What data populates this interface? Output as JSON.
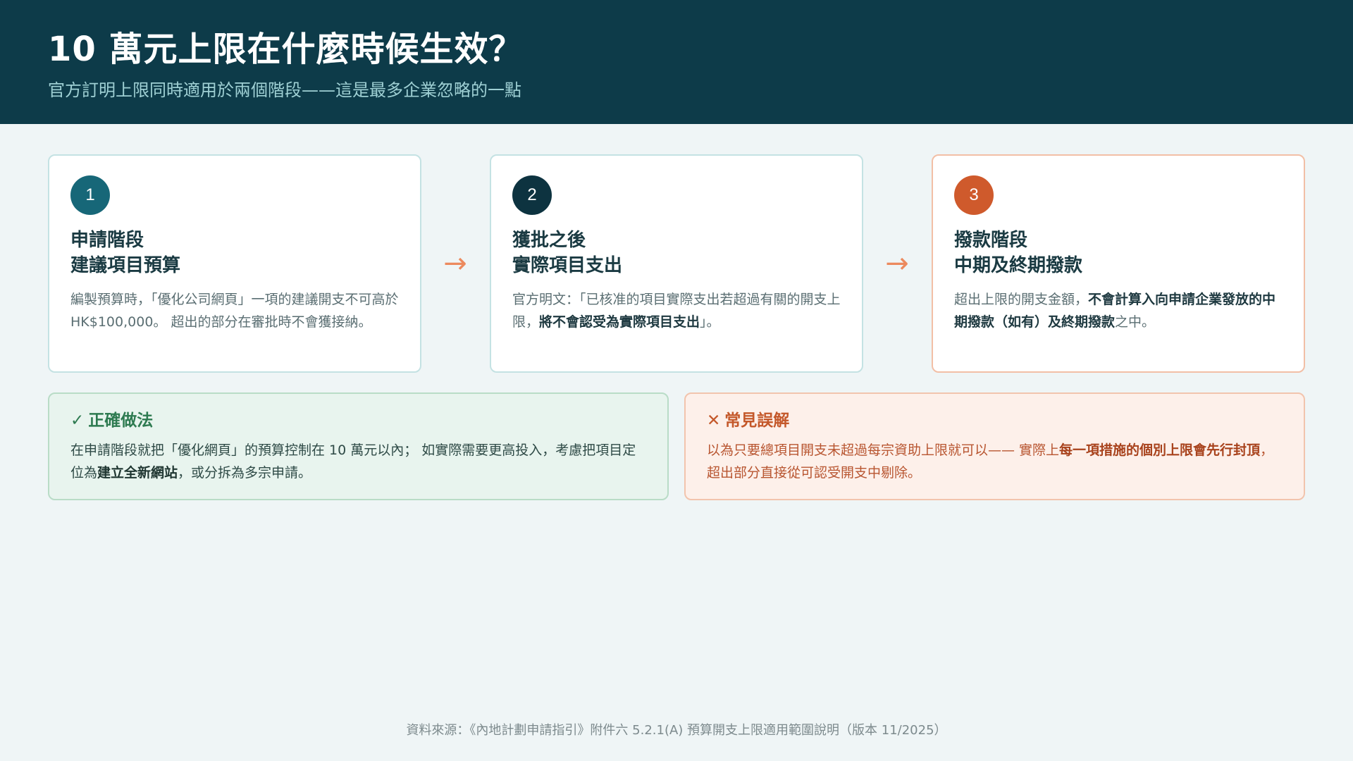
{
  "header": {
    "title": "10 萬元上限在什麼時候生效？",
    "subtitle": "官方訂明上限同時適用於兩個階段——這是最多企業忽略的一點"
  },
  "steps": [
    {
      "number": "1",
      "heading_line1": "申請階段",
      "heading_line2": "建議項目預算",
      "body": "編製預算時，「優化公司網頁」一項的建議開支不可高於 HK$100,000。 超出的部分在審批時不會獲接納。"
    },
    {
      "number": "2",
      "heading_line1": "獲批之後",
      "heading_line2": "實際項目支出",
      "body_prefix": "官方明文：「已核准的項目實際支出若超過有關的開支上限，",
      "body_bold": "將不會認受為實際項目支出",
      "body_suffix": "」。"
    },
    {
      "number": "3",
      "heading_line1": "撥款階段",
      "heading_line2": "中期及終期撥款",
      "body_prefix": "超出上限的開支金額，",
      "body_bold": "不會計算入向申請企業發放的中期撥款（如有）及終期撥款",
      "body_suffix": "之中。"
    }
  ],
  "arrows": [
    "→",
    "→"
  ],
  "correct": {
    "mark": "✓",
    "title": "正確做法",
    "body_prefix": "在申請階段就把「優化網頁」的預算控制在 10 萬元以內； 如實際需要更高投入，考慮把項目定位為",
    "body_bold": "建立全新網站",
    "body_suffix": "，或分拆為多宗申請。"
  },
  "misconception": {
    "mark": "✕",
    "title": "常見誤解",
    "body_prefix": "以為只要總項目開支未超過每宗資助上限就可以—— 實際上",
    "body_bold": "每一項措施的個別上限會先行封頂",
    "body_suffix": "，超出部分直接從可認受開支中剔除。"
  },
  "footer": "資料來源：《內地計劃申請指引》附件六 5.2.1(A) 預算開支上限適用範圍說明（版本 11/2025）",
  "colors": {
    "header_bg": "#0d3b49",
    "step1": "#176778",
    "step2": "#0d3340",
    "step3": "#cf5a2c",
    "arrow": "#ec8a5e",
    "correct": "#2d7a50",
    "misconception": "#c4582a"
  }
}
